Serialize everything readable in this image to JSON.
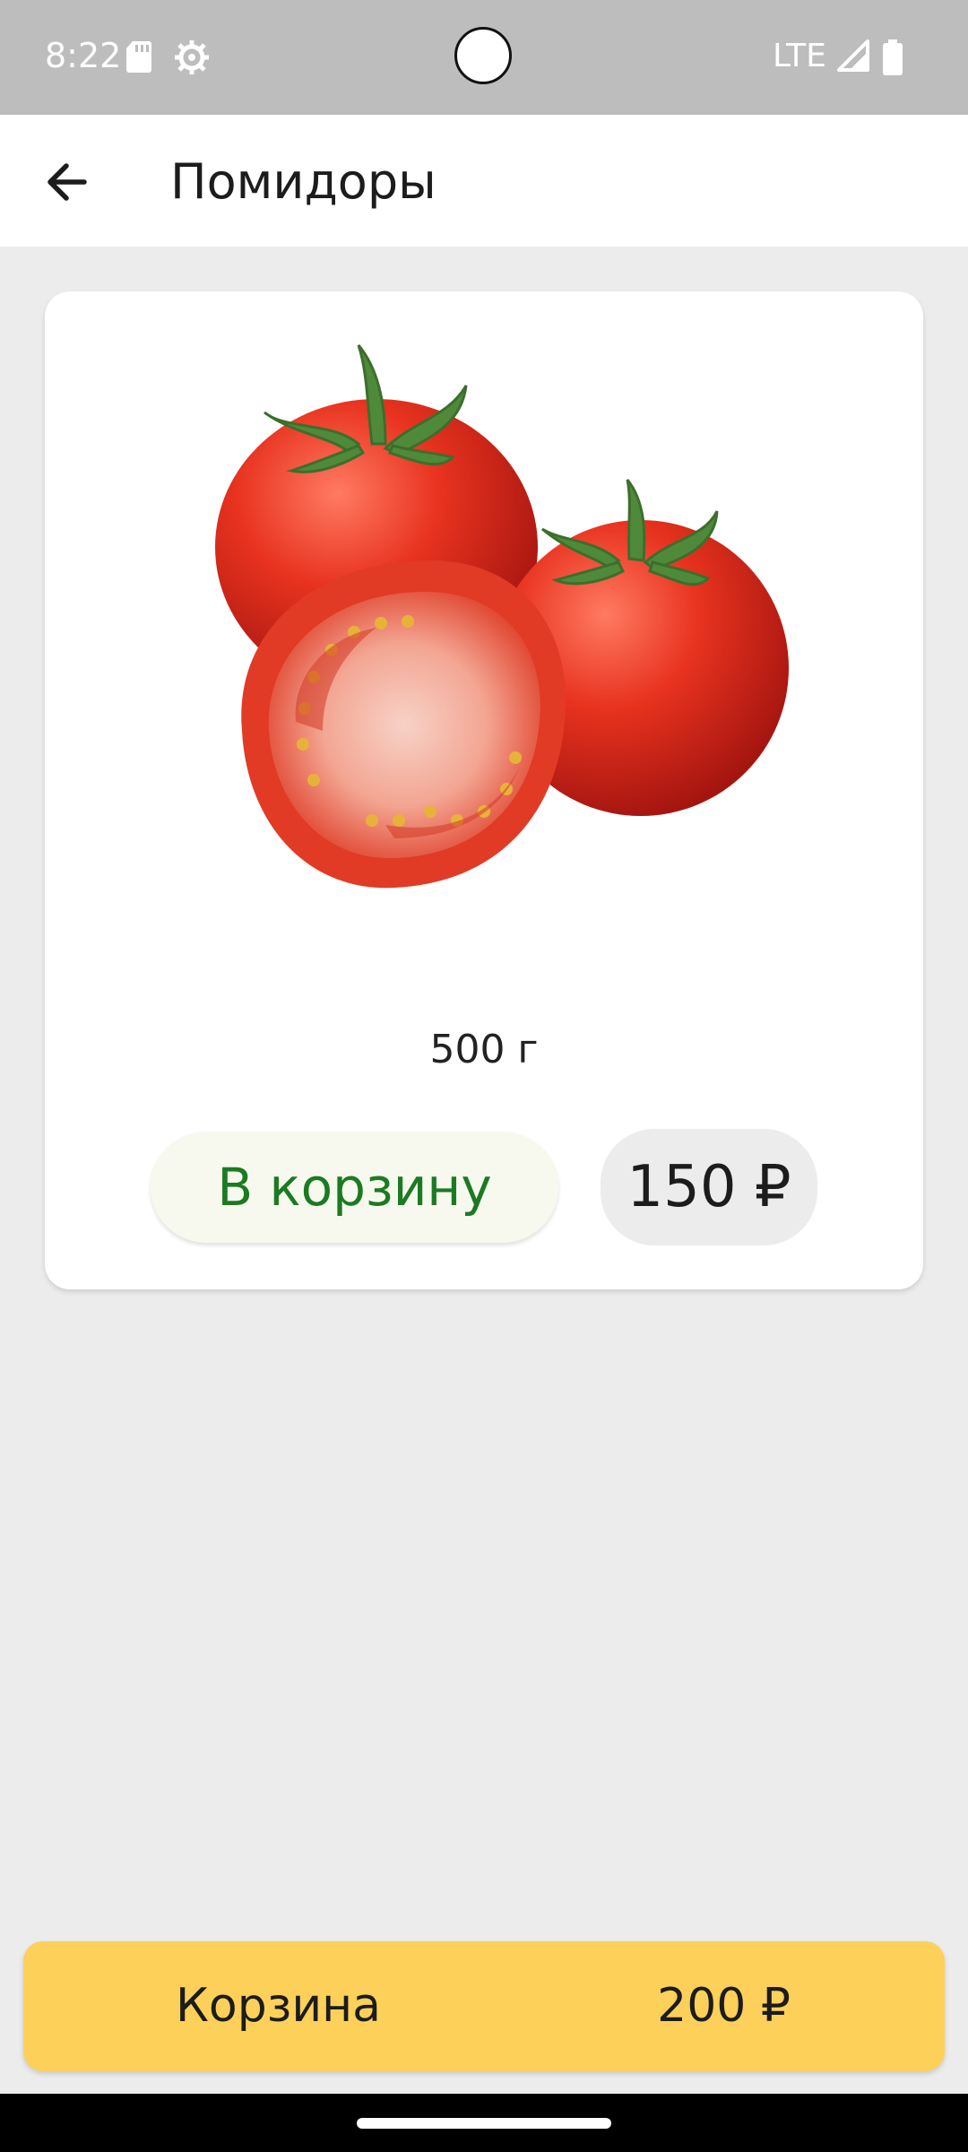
{
  "status_bar": {
    "time": "8:22",
    "network": "LTE",
    "icons": [
      "sd-card-icon",
      "settings-icon",
      "signal-icon",
      "battery-icon"
    ]
  },
  "app_bar": {
    "title": "Помидоры",
    "back_icon": "arrow-back-icon"
  },
  "product": {
    "image": "tomatoes-photo",
    "weight": "500 г",
    "add_to_cart_label": "В корзину",
    "price": "150 ₽"
  },
  "basket": {
    "label": "Корзина",
    "total": "200 ₽"
  },
  "colors": {
    "accent_green": "#1c7a22",
    "basket_yellow": "#fdd05a",
    "background": "#ececec"
  }
}
